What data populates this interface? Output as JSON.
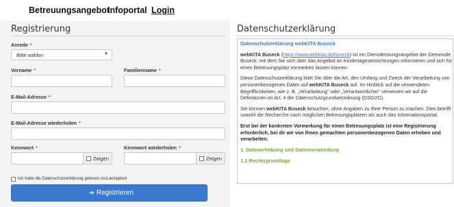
{
  "nav": {
    "items": [
      "Betreuungsangebot",
      "Infoportal",
      "Login"
    ]
  },
  "registration": {
    "title": "Registrierung",
    "required_mark": "*",
    "salutation": {
      "label": "Anrede",
      "value": "Bitte wählen"
    },
    "first_name": {
      "label": "Vorname"
    },
    "last_name": {
      "label": "Familienname"
    },
    "email": {
      "label": "E-Mail-Adresse"
    },
    "email_repeat": {
      "label": "E-Mail-Adresse wiederholen"
    },
    "password": {
      "label": "Kennwort",
      "show_label": "Zeigen"
    },
    "password_repeat": {
      "label": "Kennwort wiederholen",
      "show_label": "Zeigen"
    },
    "consent_label": "Ich habe die Datenschutzerklärung gelesen und akzeptiert",
    "submit_label": "Registrieren"
  },
  "privacy": {
    "title": "Datenschutzerklärung",
    "heading": "Datenschutzerklärung webKITA Buseck",
    "p1_name": "webKITA Buseck",
    "p1_open": " (",
    "p1_link": "https://www.webkita.de/buseck",
    "p1_rest": ") ist ein Dienstleistungsangebot der Gemeinde Buseck; mit dem Sie sich über das Angebot an Kindertageseinrichtungen informieren und sich für einen Betreuungsplatz vormerken lassen können.",
    "p2_start": "Diese Datenschutzerklärung klärt Sie über die Art, den Umfang und Zweck der Verarbeitung von personenbezogenen Daten auf ",
    "p2_name": "webKITA Buseck",
    "p2_rest": " auf. Im Hinblick auf die verwendeten Begrifflichkeiten, wie z. B. „Verarbeitung“ oder „Verantwortlicher“ verweisen wir auf die Definitionen im Art. 4 der Datenschutzgrundverordnung (DSGVO).",
    "p3_start": "Sie können ",
    "p3_name": "webKITA Buseck",
    "p3_rest": " besuchen, ohne Angaben zu Ihrer Person zu machen. Dies betrifft sowohl die Recherche nach möglichen Betreuungsplätzen als auch das Informationsportal.",
    "p4": "Erst bei der konkreten Vormerkung für einen Betreuungsplatz ist eine Registrierung erforderlich, bei dir wir von Ihnen gemachten personenbezogenen Daten erheben und verarbeiten.",
    "section1": "1. Datenerhebung und Datenverwendung",
    "section1_1": "1.1 Rechtsgrundlage"
  },
  "colors": {
    "accent": "#3a7bd1",
    "section_green": "#73ac36",
    "required": "#e0393e",
    "panel_bg": "#f4f4f4"
  }
}
